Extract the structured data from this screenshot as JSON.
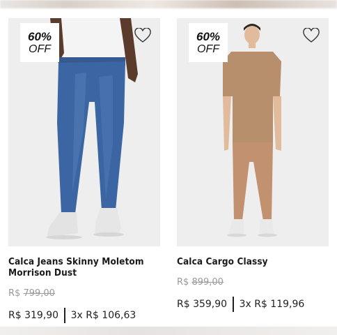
{
  "products": [
    {
      "discount_pct": "60%",
      "discount_label": "OFF",
      "favorite_icon": "heart-outline-icon",
      "name": "Calca Jeans Skinny Moletom Morrison Dust",
      "old_price_currency": "R$",
      "old_price_value": "799,00",
      "price": "R$ 319,90",
      "installments": "3x R$ 106,63",
      "colors": {
        "pants": "#3a63a0",
        "shirt": "#f3f3f3",
        "skin": "#5a3a2a",
        "shoes": "#e6e6e6"
      }
    },
    {
      "discount_pct": "60%",
      "discount_label": "OFF",
      "favorite_icon": "heart-outline-icon",
      "name": "Calca Cargo Classy",
      "old_price_currency": "R$",
      "old_price_value": "899,00",
      "price": "R$ 359,90",
      "installments": "3x R$ 119,96",
      "colors": {
        "pants": "#c08f72",
        "shirt": "#b68f6d",
        "skin": "#e0b89a",
        "shoes": "#e8e8e8"
      }
    }
  ]
}
